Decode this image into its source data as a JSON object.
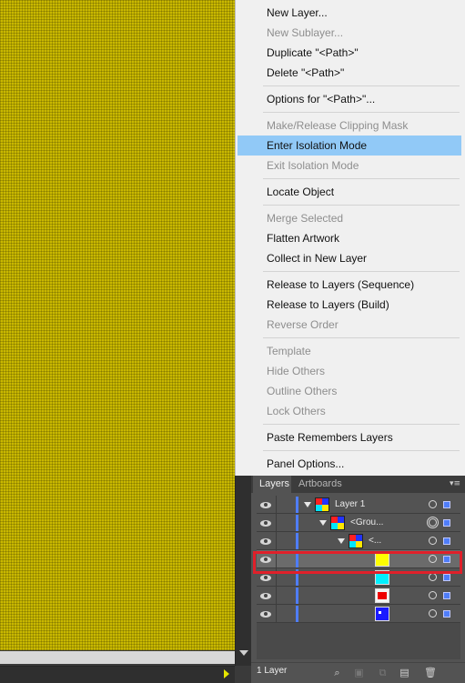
{
  "context_menu": {
    "items": [
      {
        "label": "New Layer...",
        "disabled": false
      },
      {
        "label": "New Sublayer...",
        "disabled": true
      },
      {
        "label": "Duplicate \"<Path>\"",
        "disabled": false
      },
      {
        "label": "Delete \"<Path>\"",
        "disabled": false
      },
      {
        "label": "Options for \"<Path>\"...",
        "disabled": false
      },
      {
        "label": "Make/Release Clipping Mask",
        "disabled": true
      },
      {
        "label": "Enter Isolation Mode",
        "disabled": false,
        "highlighted": true
      },
      {
        "label": "Exit Isolation Mode",
        "disabled": true
      },
      {
        "label": "Locate Object",
        "disabled": false
      },
      {
        "label": "Merge Selected",
        "disabled": true
      },
      {
        "label": "Flatten Artwork",
        "disabled": false
      },
      {
        "label": "Collect in New Layer",
        "disabled": false
      },
      {
        "label": "Release to Layers (Sequence)",
        "disabled": false
      },
      {
        "label": "Release to Layers (Build)",
        "disabled": false
      },
      {
        "label": "Reverse Order",
        "disabled": true
      },
      {
        "label": "Template",
        "disabled": true
      },
      {
        "label": "Hide Others",
        "disabled": true
      },
      {
        "label": "Outline Others",
        "disabled": true
      },
      {
        "label": "Lock Others",
        "disabled": true
      },
      {
        "label": "Paste Remembers Layers",
        "disabled": false
      },
      {
        "label": "Panel Options...",
        "disabled": false
      }
    ]
  },
  "panel": {
    "tabs": [
      "Layers",
      "Artboards"
    ],
    "active_tab": "Layers",
    "panel_menu_icon": "panel-menu-icon",
    "layers": [
      {
        "name": "Layer 1",
        "thumb": "multi"
      },
      {
        "name": "<Grou...",
        "thumb": "multi"
      },
      {
        "name": "<...",
        "thumb": "multi"
      },
      {
        "name": "",
        "thumb": "yellow",
        "selected": true
      },
      {
        "name": "",
        "thumb": "cyan"
      },
      {
        "name": "",
        "thumb": "red"
      },
      {
        "name": "",
        "thumb": "blue"
      }
    ],
    "footer_label": "1 Layer",
    "accent_color": "#4f7df9",
    "highlight_color": "#e0202a"
  },
  "canvas": {
    "fill_color": "#c9b800"
  }
}
